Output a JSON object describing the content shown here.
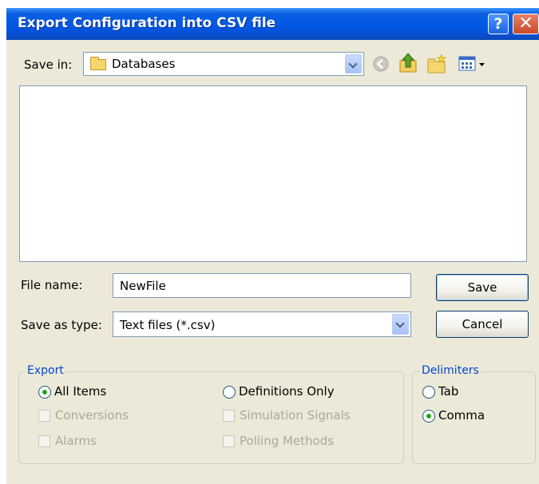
{
  "window": {
    "title": "Export Configuration into CSV file",
    "help_glyph": "?",
    "close_glyph": "✕"
  },
  "save_in": {
    "label": "Save in:",
    "folder": "Databases",
    "folder_icon": "folder-icon"
  },
  "toolbar": {
    "icons": [
      "back-icon",
      "up-one-level-icon",
      "new-folder-icon",
      "view-menu-icon"
    ]
  },
  "file_name": {
    "label": "File name:",
    "value": "NewFile"
  },
  "save_as_type": {
    "label": "Save as type:",
    "value": "Text files (*.csv)"
  },
  "buttons": {
    "save": "Save",
    "cancel": "Cancel"
  },
  "export_group": {
    "title": "Export",
    "all_items": "All Items",
    "definitions_only": "Definitions Only",
    "conversions": "Conversions",
    "simulation_signals": "Simulation Signals",
    "alarms": "Alarms",
    "polling_methods": "Polling Methods",
    "selected": "All Items"
  },
  "delimiters_group": {
    "title": "Delimiters",
    "tab": "Tab",
    "comma": "Comma",
    "selected": "Comma"
  },
  "colors": {
    "titlebar": "#0058e6",
    "dialog_bg": "#ece9d8",
    "group_title": "#0046d5",
    "disabled_text": "#aca899"
  }
}
